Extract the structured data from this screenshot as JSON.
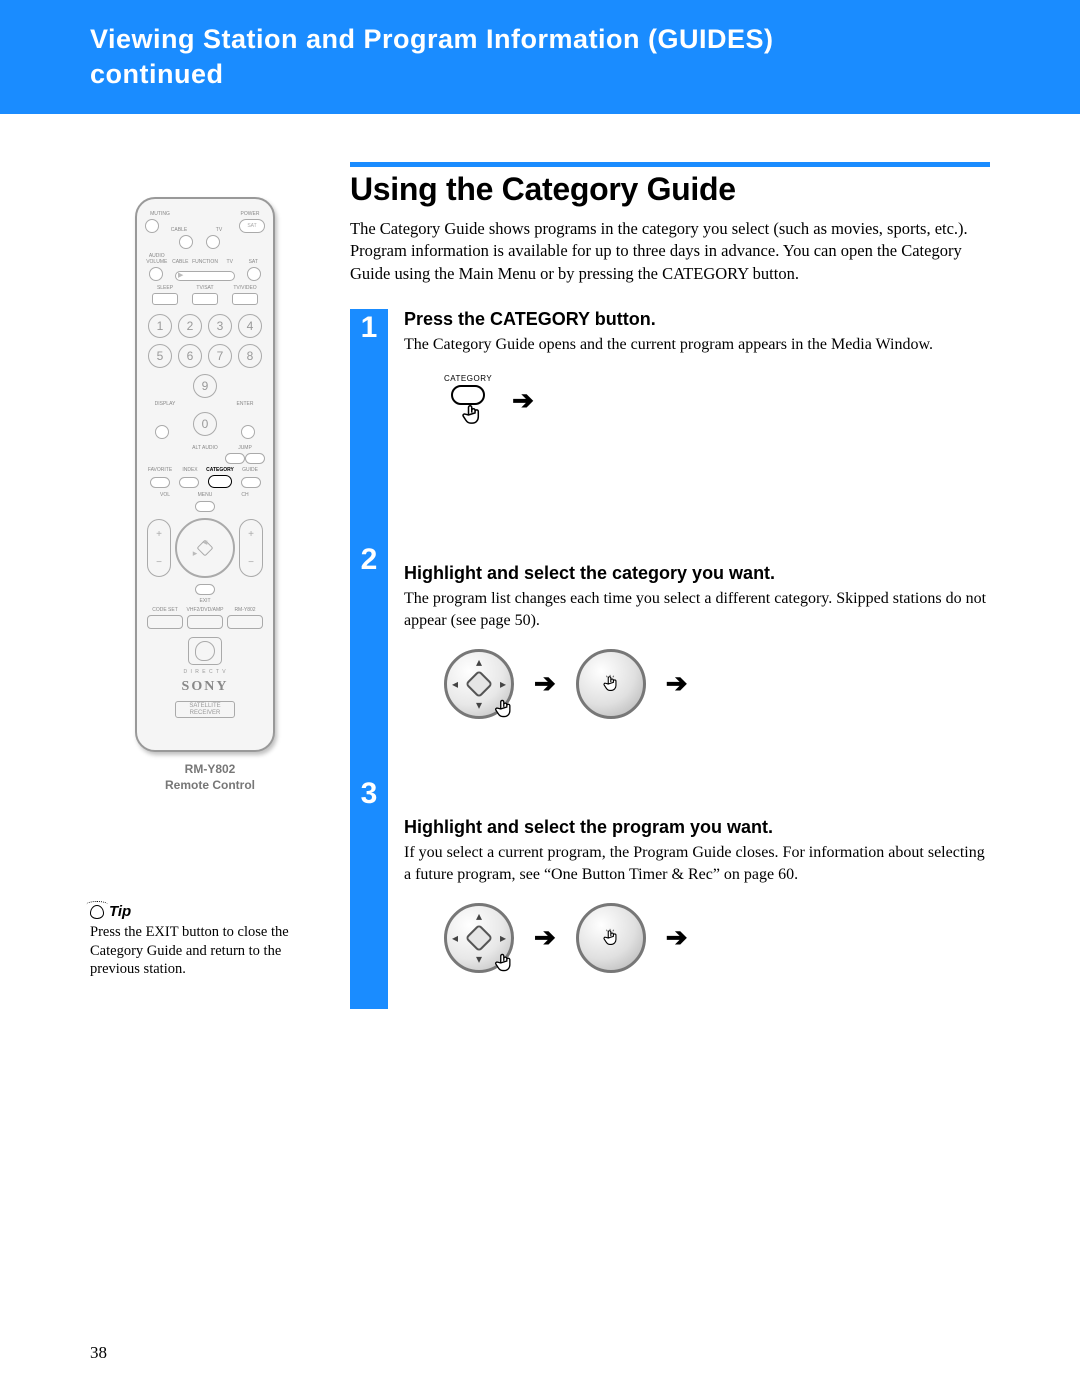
{
  "header": {
    "line1": "Viewing Station and Program Information (GUIDES)",
    "line2": "continued"
  },
  "section_title": "Using the Category Guide",
  "intro": "The Category Guide shows programs in the category you select (such as movies, sports, etc.). Program information is available for up to three days in advance. You can open the Category Guide using the Main Menu or by pressing the CATEGORY button.",
  "steps": [
    {
      "num": "1",
      "head": "Press the CATEGORY button.",
      "body": "The Category Guide opens and the current program appears in the Media Window.",
      "diagram_label": "CATEGORY"
    },
    {
      "num": "2",
      "head": "Highlight and select the category you want.",
      "body": "The program list changes each time you select a different category. Skipped stations do not appear (see page 50)."
    },
    {
      "num": "3",
      "head": "Highlight and select the program you want.",
      "body": "If you select a current program, the Program Guide closes. For information about selecting a future program, see “One Button Timer & Rec” on page 60."
    }
  ],
  "remote": {
    "model": "RM-Y802",
    "caption": "Remote Control",
    "top_labels_r1": [
      "MUTING",
      "",
      "",
      "POWER"
    ],
    "top_labels_r2": [
      "",
      "CABLE",
      "TV",
      "SAT"
    ],
    "row3_labels": [
      "AUDIO VOLUME",
      "CABLE",
      "FUNCTION",
      "TV",
      "SAT"
    ],
    "row4_labels": [
      "SLEEP",
      "TV/SAT",
      "TV/VIDEO"
    ],
    "numpad": [
      "1",
      "2",
      "3",
      "4",
      "5",
      "6",
      "7",
      "8",
      "9",
      "0"
    ],
    "display_enter": [
      "DISPLAY",
      "",
      "ENTER"
    ],
    "alt_audio": "ALT AUDIO",
    "jump": "JUMP",
    "fav_row": [
      "FAVORITE",
      "INDEX",
      "CATEGORY",
      "GUIDE"
    ],
    "vol": "VOL",
    "ch": "CH",
    "menu": "MENU",
    "exit": "EXIT",
    "bottom_row": [
      "CODE SET",
      "VHF2/DVD/AMP",
      "RM-Y802"
    ],
    "directv": "D I R E C T V",
    "brand": "SONY",
    "sat_receiver": "SATELLITE\nRECEIVER"
  },
  "tip": {
    "label": "Tip",
    "body": "Press the EXIT button to close the Category Guide and return to the previous station."
  },
  "page_number": "38"
}
